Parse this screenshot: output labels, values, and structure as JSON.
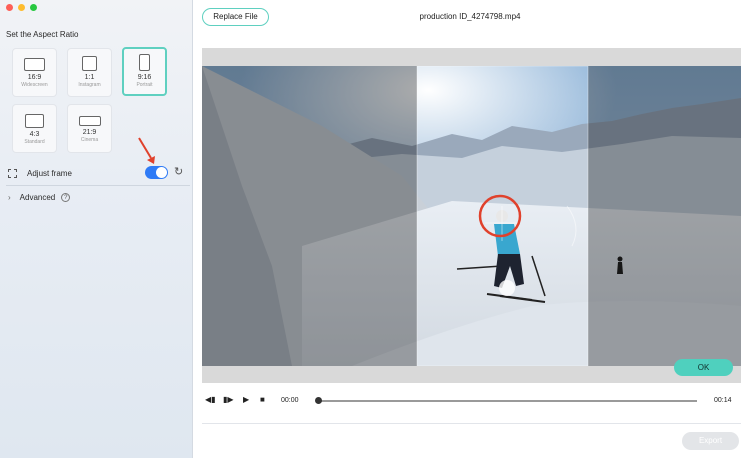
{
  "window": {
    "traffic_lights": [
      "close",
      "minimize",
      "zoom"
    ]
  },
  "sidebar": {
    "section_title": "Set the Aspect Ratio",
    "ratios": [
      {
        "label": "16:9",
        "sub": "Widescreen",
        "selected": false
      },
      {
        "label": "1:1",
        "sub": "Instagram",
        "selected": false
      },
      {
        "label": "9:16",
        "sub": "Portrait",
        "selected": true
      },
      {
        "label": "4:3",
        "sub": "Standard",
        "selected": false
      },
      {
        "label": "21:9",
        "sub": "Cinema",
        "selected": false
      }
    ],
    "adjust_frame": {
      "label": "Adjust frame",
      "enabled": true
    },
    "advanced_label": "Advanced",
    "help_glyph": "?"
  },
  "header": {
    "replace_file_label": "Replace File",
    "file_name": "production ID_4274798.mp4"
  },
  "preview": {
    "ok_label": "OK"
  },
  "player": {
    "current_time": "00:00",
    "duration": "00:14",
    "progress": 0
  },
  "footer": {
    "export_label": "Export"
  },
  "colors": {
    "accent": "#5fd0c0",
    "toggle": "#2f7bf6",
    "arrow": "#e0412c",
    "highlight_circle": "#e0412c"
  }
}
